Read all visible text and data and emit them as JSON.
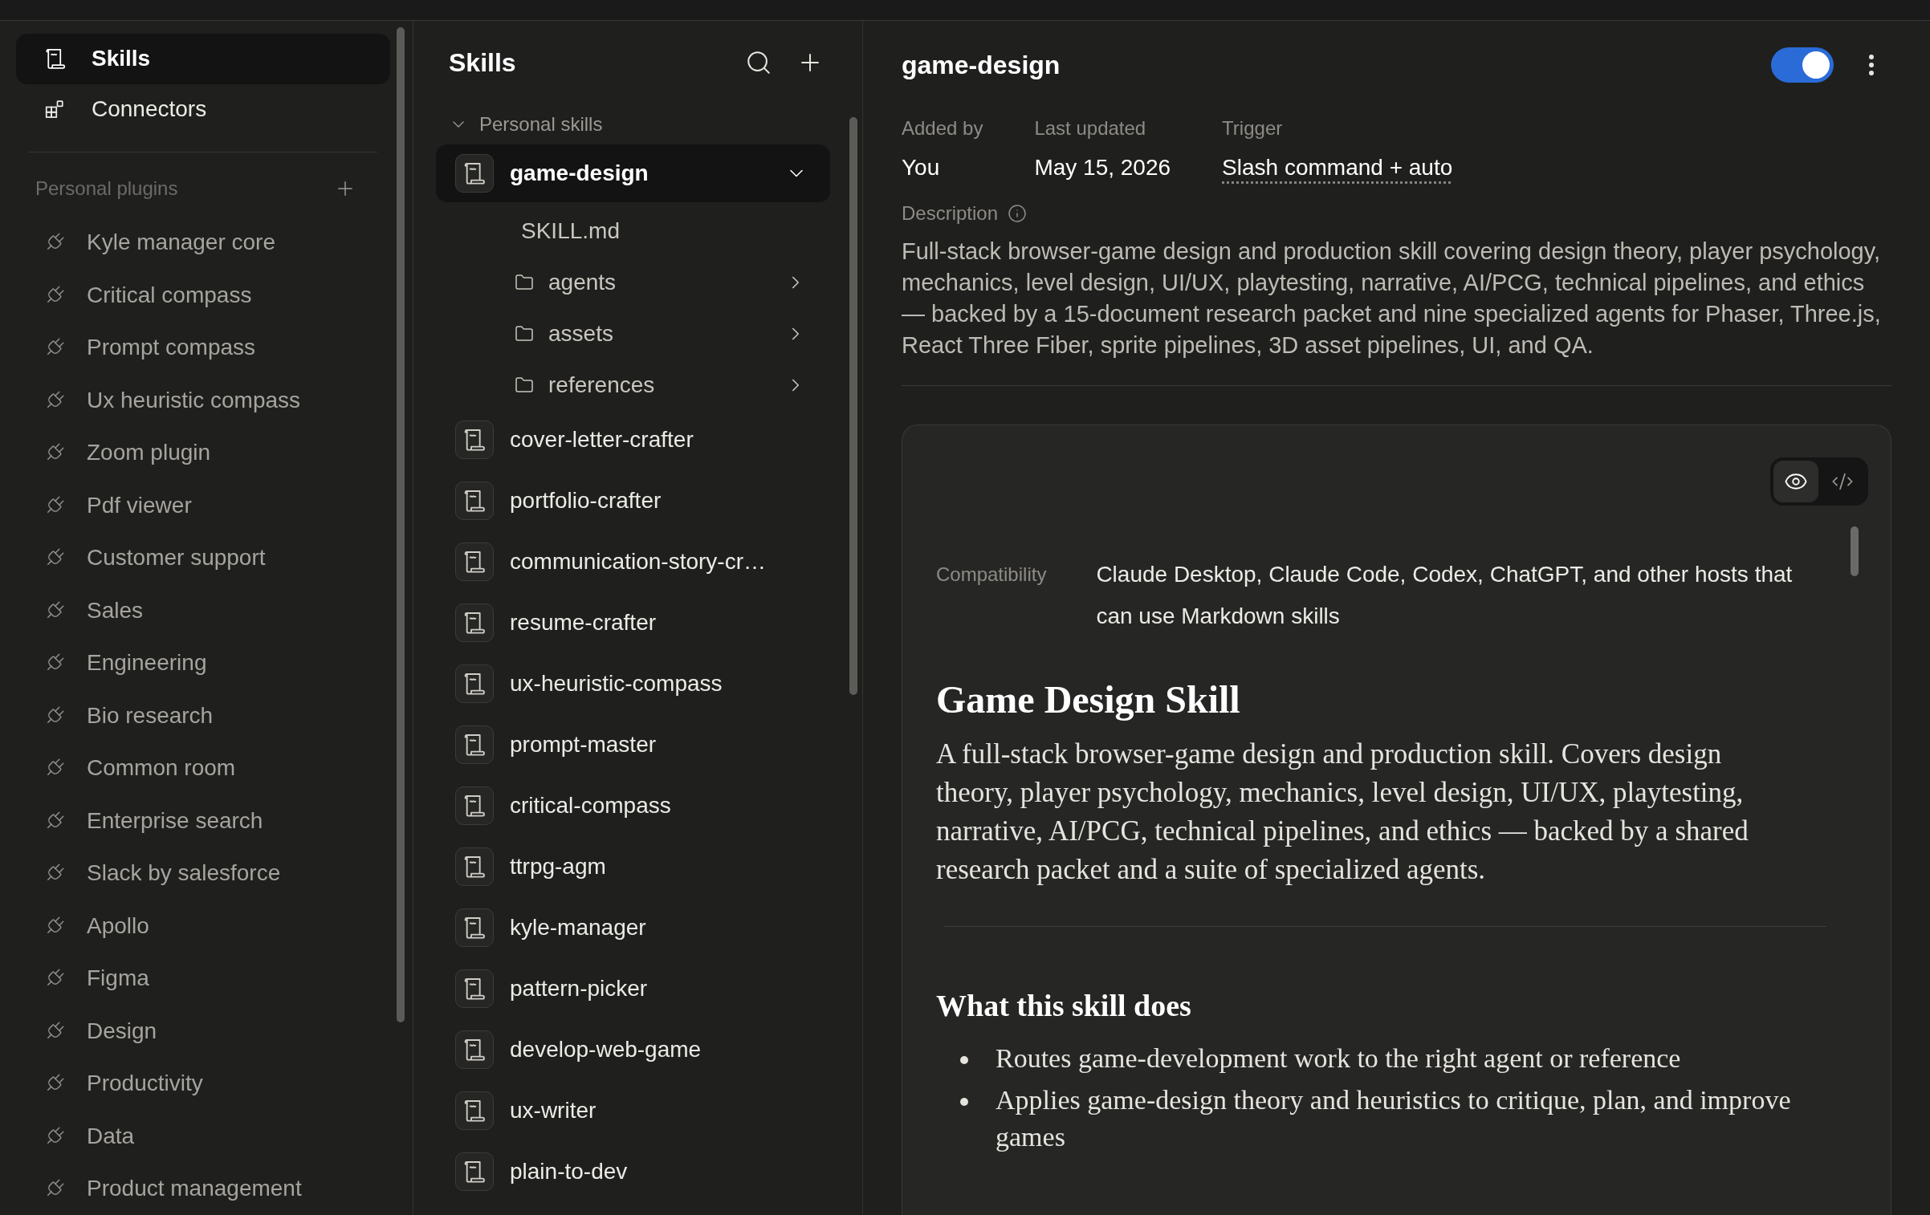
{
  "sidebar": {
    "nav": [
      {
        "label": "Skills",
        "kind": "skills",
        "selected": true
      },
      {
        "label": "Connectors",
        "kind": "connectors",
        "selected": false
      }
    ],
    "section_title": "Personal plugins",
    "plugins": [
      "Kyle manager core",
      "Critical compass",
      "Prompt compass",
      "Ux heuristic compass",
      "Zoom plugin",
      "Pdf viewer",
      "Customer support",
      "Sales",
      "Engineering",
      "Bio research",
      "Common room",
      "Enterprise search",
      "Slack by salesforce",
      "Apollo",
      "Figma",
      "Design",
      "Productivity",
      "Data",
      "Product management"
    ]
  },
  "skills_panel": {
    "title": "Skills",
    "group": {
      "label": "Personal skills",
      "expanded": true
    },
    "skills": [
      {
        "name": "game-design",
        "selected": true,
        "expanded": true,
        "children": [
          {
            "name": "SKILL.md",
            "kind": "file"
          },
          {
            "name": "agents",
            "kind": "folder"
          },
          {
            "name": "assets",
            "kind": "folder"
          },
          {
            "name": "references",
            "kind": "folder"
          }
        ]
      },
      {
        "name": "cover-letter-crafter",
        "selected": false,
        "expanded": false
      },
      {
        "name": "portfolio-crafter",
        "selected": false,
        "expanded": false
      },
      {
        "name": "communication-story-cr…",
        "selected": false,
        "expanded": false
      },
      {
        "name": "resume-crafter",
        "selected": false,
        "expanded": false
      },
      {
        "name": "ux-heuristic-compass",
        "selected": false,
        "expanded": false
      },
      {
        "name": "prompt-master",
        "selected": false,
        "expanded": false
      },
      {
        "name": "critical-compass",
        "selected": false,
        "expanded": false
      },
      {
        "name": "ttrpg-agm",
        "selected": false,
        "expanded": false
      },
      {
        "name": "kyle-manager",
        "selected": false,
        "expanded": false
      },
      {
        "name": "pattern-picker",
        "selected": false,
        "expanded": false
      },
      {
        "name": "develop-web-game",
        "selected": false,
        "expanded": false
      },
      {
        "name": "ux-writer",
        "selected": false,
        "expanded": false
      },
      {
        "name": "plain-to-dev",
        "selected": false,
        "expanded": false
      }
    ]
  },
  "detail": {
    "title": "game-design",
    "enabled": true,
    "meta": [
      {
        "label": "Added by",
        "value": "You",
        "underlined": false
      },
      {
        "label": "Last updated",
        "value": "May 15, 2026",
        "underlined": false
      },
      {
        "label": "Trigger",
        "value": "Slash command + auto",
        "underlined": true
      }
    ],
    "description_label": "Description",
    "description": "Full-stack browser-game design and production skill covering design theory, player psychology, mechanics, level design, UI/UX, playtesting, narrative, AI/PCG, technical pipelines, and ethics — backed by a 15-document research packet and nine specialized agents for Phaser, Three.js, React Three Fiber, sprite pipelines, 3D asset pipelines, UI, and QA.",
    "view_modes": [
      {
        "kind": "preview",
        "selected": true
      },
      {
        "kind": "code",
        "selected": false
      }
    ],
    "document": {
      "compatibility_label": "Compatibility",
      "compatibility": "Claude Desktop, Claude Code, Codex, ChatGPT, and other hosts that can use Markdown skills",
      "heading": "Game Design Skill",
      "intro": "A full-stack browser-game design and production skill. Covers design theory, player psychology, mechanics, level design, UI/UX, playtesting, narrative, AI/PCG, technical pipelines, and ethics — backed by a shared research packet and a suite of specialized agents.",
      "subheading": "What this skill does",
      "bullets": [
        "Routes game-development work to the right agent or reference",
        "Applies game-design theory and heuristics to critique, plan, and improve games"
      ]
    }
  }
}
